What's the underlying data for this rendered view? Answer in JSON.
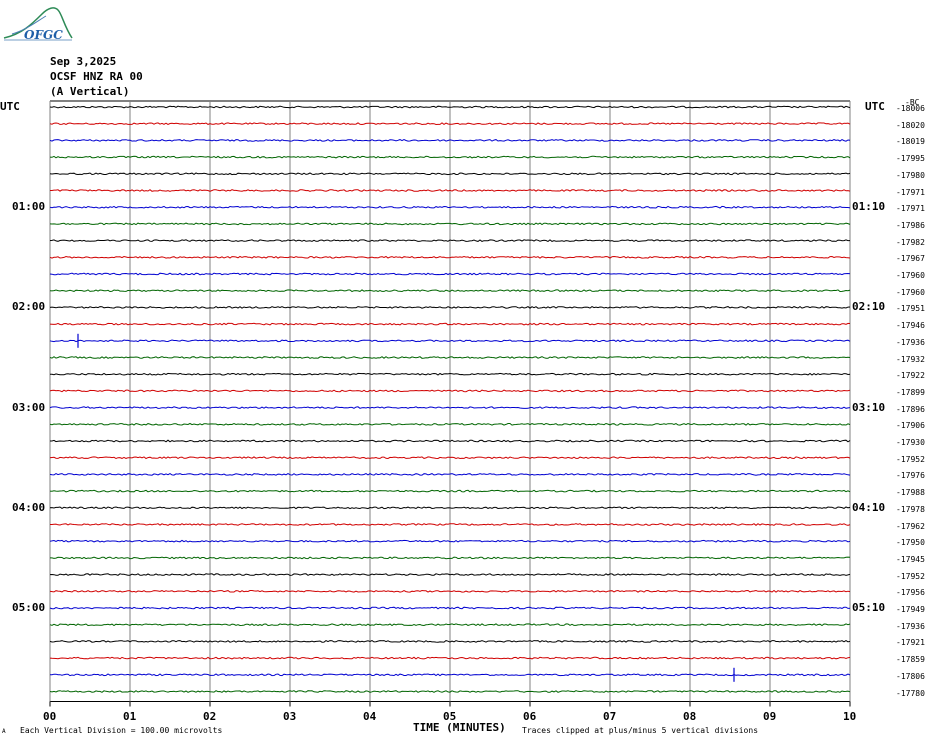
{
  "logo": {
    "text": "OFGC"
  },
  "header": {
    "date": "Sep 3,2025",
    "station": "OCSF HNZ RA 00",
    "component": "(A Vertical)"
  },
  "left_label": "UTC",
  "right_label": "UTC",
  "right_top_label": "-BC",
  "footer": {
    "left_note": "Each Vertical Division =  100.00 microvolts",
    "xlabel": "TIME (MINUTES)",
    "right_note": "Traces clipped at plus/minus 5 vertical divisions",
    "corner": "A"
  },
  "colors": {
    "cycle": [
      "#000000",
      "#d00000",
      "#0000d0",
      "#006400"
    ],
    "grid": "#808080"
  },
  "chart_data": {
    "type": "line",
    "title": "",
    "xlabel": "TIME (MINUTES)",
    "ylabel": "",
    "xlim": [
      0,
      10
    ],
    "x_ticks": [
      "00",
      "01",
      "02",
      "03",
      "04",
      "05",
      "06",
      "07",
      "08",
      "09",
      "10"
    ],
    "trace_count": 36,
    "left_times": [
      {
        "row": 6,
        "label": "01:00"
      },
      {
        "row": 12,
        "label": "02:00"
      },
      {
        "row": 18,
        "label": "03:00"
      },
      {
        "row": 24,
        "label": "04:00"
      },
      {
        "row": 30,
        "label": "05:00"
      }
    ],
    "right_times": [
      {
        "row": 6,
        "label": "01:10"
      },
      {
        "row": 12,
        "label": "02:10"
      },
      {
        "row": 18,
        "label": "03:10"
      },
      {
        "row": 24,
        "label": "04:10"
      },
      {
        "row": 30,
        "label": "05:10"
      }
    ],
    "trace_offsets": [
      "-18006",
      "-18020",
      "-18019",
      "-17995",
      "-17980",
      "-17971",
      "-17971",
      "-17986",
      "-17982",
      "-17967",
      "-17960",
      "-17960",
      "-17951",
      "-17946",
      "-17936",
      "-17932",
      "-17922",
      "-17899",
      "-17896",
      "-17906",
      "-17930",
      "-17952",
      "-17976",
      "-17988",
      "-17978",
      "-17962",
      "-17950",
      "-17945",
      "-17952",
      "-17956",
      "-17949",
      "-17936",
      "-17921",
      "-17859",
      "-17806",
      "-17780"
    ],
    "events": [
      {
        "row": 14,
        "minute": 0.35
      },
      {
        "row": 34,
        "minute": 8.55
      }
    ]
  }
}
